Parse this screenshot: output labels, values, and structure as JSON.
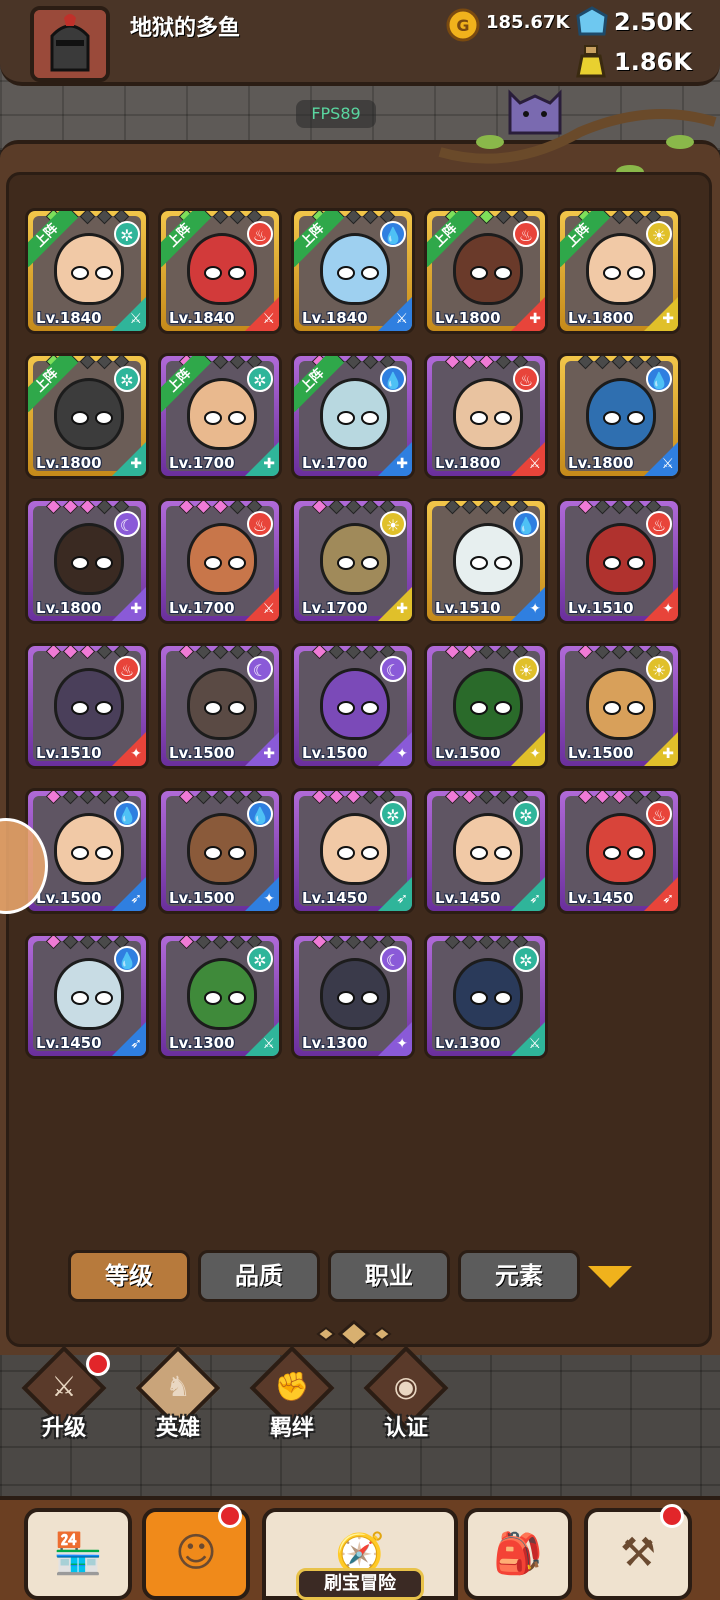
{
  "player": {
    "name": "地狱的多鱼",
    "avatar_icon": "knight-helmet-avatar"
  },
  "resources": {
    "gold": {
      "icon": "gold-coin-icon",
      "value": "185.67K"
    },
    "gems": {
      "icon": "blue-crystal-icon",
      "value": "2.50K"
    },
    "potion": {
      "icon": "potion-bottle-icon",
      "value": "1.86K"
    }
  },
  "fps": "FPS89",
  "deploy_label": "上阵",
  "elements": {
    "wind": {
      "glyph": "✲",
      "color": "#2fb59a"
    },
    "fire": {
      "glyph": "♨",
      "color": "#e8443a"
    },
    "water": {
      "glyph": "💧",
      "color": "#2f7fe0"
    },
    "light": {
      "glyph": "☀",
      "color": "#e0c02a"
    },
    "dark": {
      "glyph": "☾",
      "color": "#8a5ad8"
    }
  },
  "heroes": [
    {
      "level": "Lv.1840",
      "frame": "gold",
      "deployed": true,
      "element": "wind",
      "role": "sword",
      "gems": [
        "green",
        "dark",
        "dark",
        "dark",
        "dark"
      ],
      "skin": "#f1c9a6"
    },
    {
      "level": "Lv.1840",
      "frame": "gold",
      "deployed": true,
      "element": "fire",
      "role": "sword",
      "gems": [
        "green",
        "dark",
        "dark",
        "dark",
        "dark"
      ],
      "skin": "#d23a3a"
    },
    {
      "level": "Lv.1840",
      "frame": "gold",
      "deployed": true,
      "element": "water",
      "role": "sword",
      "gems": [
        "green",
        "dark",
        "dark",
        "dark",
        "dark"
      ],
      "skin": "#9ed0f0"
    },
    {
      "level": "Lv.1800",
      "frame": "gold",
      "deployed": true,
      "element": "fire",
      "role": "shield",
      "gems": [
        "green",
        "green",
        "green",
        "dark",
        "dark"
      ],
      "skin": "#6a3a2a"
    },
    {
      "level": "Lv.1800",
      "frame": "gold",
      "deployed": true,
      "element": "light",
      "role": "shield",
      "gems": [
        "green",
        "dark",
        "dark",
        "dark",
        "dark"
      ],
      "skin": "#f1c9a6"
    },
    {
      "level": "Lv.1800",
      "frame": "gold",
      "deployed": true,
      "element": "wind",
      "role": "shield",
      "gems": [
        "green",
        "dark",
        "dark",
        "dark",
        "dark"
      ],
      "skin": "#3c3c3c"
    },
    {
      "level": "Lv.1700",
      "frame": "purple",
      "deployed": true,
      "element": "wind",
      "role": "shield",
      "gems": [
        "pink",
        "dark",
        "dark",
        "dark",
        "dark"
      ],
      "skin": "#e9b98e"
    },
    {
      "level": "Lv.1700",
      "frame": "purple",
      "deployed": true,
      "element": "water",
      "role": "shield",
      "gems": [
        "pink",
        "dark",
        "dark",
        "dark",
        "dark"
      ],
      "skin": "#b8d8e0"
    },
    {
      "level": "Lv.1800",
      "frame": "purple",
      "deployed": false,
      "element": "fire",
      "role": "sword",
      "gems": [
        "pink",
        "pink",
        "pink",
        "dark",
        "dark"
      ],
      "skin": "#e9c3a0"
    },
    {
      "level": "Lv.1800",
      "frame": "gold",
      "deployed": false,
      "element": "water",
      "role": "sword",
      "gems": [
        "dark",
        "dark",
        "dark",
        "dark",
        "dark"
      ],
      "skin": "#2f6fb0"
    },
    {
      "level": "Lv.1800",
      "frame": "purple",
      "deployed": false,
      "element": "dark",
      "role": "shield",
      "gems": [
        "pink",
        "pink",
        "pink",
        "dark",
        "dark"
      ],
      "skin": "#3a2a22"
    },
    {
      "level": "Lv.1700",
      "frame": "purple",
      "deployed": false,
      "element": "fire",
      "role": "sword",
      "gems": [
        "pink",
        "pink",
        "pink",
        "dark",
        "dark"
      ],
      "skin": "#c8764a"
    },
    {
      "level": "Lv.1700",
      "frame": "purple",
      "deployed": false,
      "element": "light",
      "role": "shield",
      "gems": [
        "pink",
        "dark",
        "dark",
        "dark",
        "dark"
      ],
      "skin": "#a08a5a"
    },
    {
      "level": "Lv.1510",
      "frame": "gold",
      "deployed": false,
      "element": "water",
      "role": "staff",
      "gems": [
        "dark",
        "dark",
        "dark",
        "dark",
        "dark"
      ],
      "skin": "#e7efef"
    },
    {
      "level": "Lv.1510",
      "frame": "purple",
      "deployed": false,
      "element": "fire",
      "role": "staff",
      "gems": [
        "pink",
        "dark",
        "dark",
        "dark",
        "dark"
      ],
      "skin": "#b0322e"
    },
    {
      "level": "Lv.1510",
      "frame": "purple",
      "deployed": false,
      "element": "fire",
      "role": "staff",
      "gems": [
        "pink",
        "pink",
        "pink",
        "dark",
        "dark"
      ],
      "skin": "#4a3f5a"
    },
    {
      "level": "Lv.1500",
      "frame": "purple",
      "deployed": false,
      "element": "dark",
      "role": "shield",
      "gems": [
        "pink",
        "dark",
        "dark",
        "dark",
        "dark"
      ],
      "skin": "#5a4a44"
    },
    {
      "level": "Lv.1500",
      "frame": "purple",
      "deployed": false,
      "element": "dark",
      "role": "staff",
      "gems": [
        "pink",
        "dark",
        "dark",
        "dark",
        "dark"
      ],
      "skin": "#7b4ab8"
    },
    {
      "level": "Lv.1500",
      "frame": "purple",
      "deployed": false,
      "element": "light",
      "role": "staff",
      "gems": [
        "pink",
        "pink",
        "dark",
        "dark",
        "dark"
      ],
      "skin": "#2a6a2a"
    },
    {
      "level": "Lv.1500",
      "frame": "purple",
      "deployed": false,
      "element": "light",
      "role": "shield",
      "gems": [
        "pink",
        "dark",
        "dark",
        "dark",
        "dark"
      ],
      "skin": "#d8a05a"
    },
    {
      "level": "Lv.1500",
      "frame": "purple",
      "deployed": false,
      "element": "water",
      "role": "bow",
      "gems": [
        "pink",
        "dark",
        "dark",
        "dark",
        "dark"
      ],
      "skin": "#f1c9a6"
    },
    {
      "level": "Lv.1500",
      "frame": "purple",
      "deployed": false,
      "element": "water",
      "role": "staff",
      "gems": [
        "pink",
        "dark",
        "dark",
        "dark",
        "dark"
      ],
      "skin": "#8a5a3a"
    },
    {
      "level": "Lv.1450",
      "frame": "purple",
      "deployed": false,
      "element": "wind",
      "role": "bow",
      "gems": [
        "pink",
        "pink",
        "pink",
        "dark",
        "dark"
      ],
      "skin": "#f1c9a6"
    },
    {
      "level": "Lv.1450",
      "frame": "purple",
      "deployed": false,
      "element": "wind",
      "role": "bow",
      "gems": [
        "pink",
        "pink",
        "dark",
        "dark",
        "dark"
      ],
      "skin": "#f1c9a6"
    },
    {
      "level": "Lv.1450",
      "frame": "purple",
      "deployed": false,
      "element": "fire",
      "role": "bow",
      "gems": [
        "pink",
        "pink",
        "pink",
        "dark",
        "dark"
      ],
      "skin": "#d8443a"
    },
    {
      "level": "Lv.1450",
      "frame": "purple",
      "deployed": false,
      "element": "water",
      "role": "bow",
      "gems": [
        "pink",
        "dark",
        "dark",
        "dark",
        "dark"
      ],
      "skin": "#c8dce4"
    },
    {
      "level": "Lv.1300",
      "frame": "purple",
      "deployed": false,
      "element": "wind",
      "role": "sword",
      "gems": [
        "pink",
        "dark",
        "dark",
        "dark",
        "dark"
      ],
      "skin": "#3f8a3a"
    },
    {
      "level": "Lv.1300",
      "frame": "purple",
      "deployed": false,
      "element": "dark",
      "role": "staff",
      "gems": [
        "pink",
        "dark",
        "dark",
        "dark",
        "dark"
      ],
      "skin": "#3a3a4a"
    },
    {
      "level": "Lv.1300",
      "frame": "purple",
      "deployed": false,
      "element": "wind",
      "role": "sword",
      "gems": [
        "dark",
        "dark",
        "dark",
        "dark",
        "dark"
      ],
      "skin": "#2a3a5a"
    }
  ],
  "role_glyphs": {
    "sword": "⚔",
    "shield": "✚",
    "staff": "✦",
    "bow": "➶"
  },
  "role_colors": {
    "sword": "#2a9a6a",
    "shield": "#2a8a5a",
    "staff": "#6a4ac8",
    "bow": "#2a7ab8"
  },
  "filters": {
    "level": "等级",
    "quality": "品质",
    "class": "职业",
    "element": "元素"
  },
  "subnav": {
    "upgrade": "升级",
    "heroes": "英雄",
    "bond": "羁绊",
    "certify": "认证"
  },
  "bottom": {
    "adventure": "刷宝冒险"
  }
}
